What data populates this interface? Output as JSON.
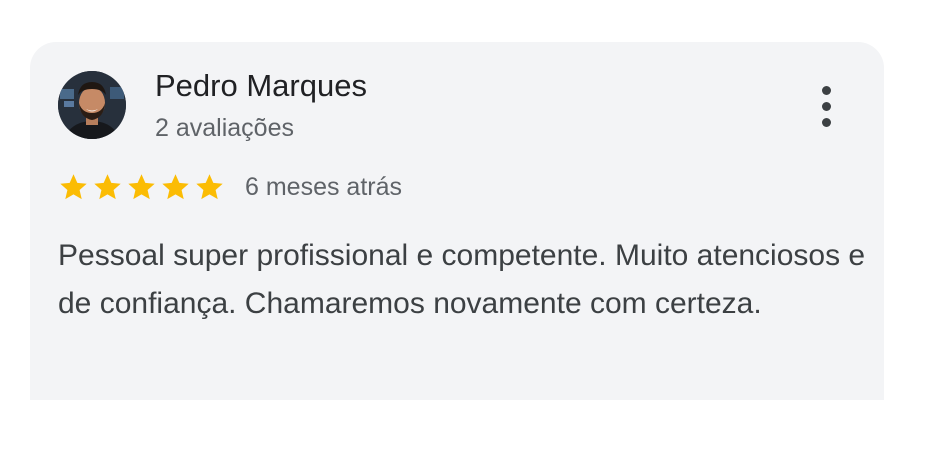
{
  "review": {
    "reviewer_name": "Pedro Marques",
    "review_count": "2 avaliações",
    "rating": 5,
    "max_rating": 5,
    "time_ago": "6 meses atrás",
    "text": "Pessoal super profissional e competente. Muito atenciosos e de confiança. Chamaremos novamente com certeza."
  },
  "icons": {
    "more": "more-vert-icon",
    "star": "star-icon"
  },
  "colors": {
    "card_background": "#f3f4f6",
    "star": "#fbbc04",
    "primary_text": "#202124",
    "secondary_text": "#5f6368",
    "body_text": "#3c4043"
  }
}
